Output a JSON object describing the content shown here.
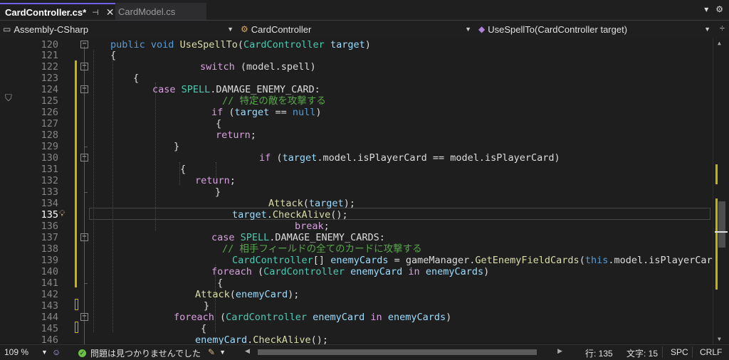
{
  "tabs": [
    {
      "label": "CardController.cs*",
      "pin": "⊣",
      "close": "✕"
    },
    {
      "label": "CardModel.cs"
    }
  ],
  "nav": {
    "project": "Assembly-CSharp",
    "class": "CardController",
    "member": "UseSpellTo(CardController target)"
  },
  "line_numbers": [
    "120",
    "121",
    "122",
    "123",
    "124",
    "125",
    "126",
    "127",
    "128",
    "129",
    "130",
    "131",
    "132",
    "133",
    "134",
    "135",
    "136",
    "137",
    "138",
    "139",
    "140",
    "141",
    "142",
    "143",
    "144",
    "145",
    "146"
  ],
  "current_line": "135",
  "code_lines": [
    [
      {
        "c": "kw",
        "t": "public"
      },
      {
        "c": "pln",
        "t": " "
      },
      {
        "c": "kw",
        "t": "void"
      },
      {
        "c": "pln",
        "t": " "
      },
      {
        "c": "mth",
        "t": "UseSpellTo"
      },
      {
        "c": "pln",
        "t": "("
      },
      {
        "c": "typ",
        "t": "CardController"
      },
      {
        "c": "pln",
        "t": " "
      },
      {
        "c": "prm",
        "t": "target"
      },
      {
        "c": "pln",
        "t": ")"
      }
    ],
    [
      {
        "c": "pln",
        "t": "{"
      }
    ],
    [
      {
        "c": "ctl",
        "t": "switch"
      },
      {
        "c": "pln",
        "t": " (model.spell)"
      }
    ],
    [
      {
        "c": "pln",
        "t": "{"
      }
    ],
    [
      {
        "c": "ctl",
        "t": "case"
      },
      {
        "c": "pln",
        "t": " "
      },
      {
        "c": "typ",
        "t": "SPELL"
      },
      {
        "c": "pln",
        "t": ".DAMAGE_ENEMY_CARD:"
      }
    ],
    [
      {
        "c": "cmt",
        "t": "// 特定の敵を攻撃する"
      }
    ],
    [
      {
        "c": "ctl",
        "t": "if"
      },
      {
        "c": "pln",
        "t": " ("
      },
      {
        "c": "prm",
        "t": "target"
      },
      {
        "c": "pln",
        "t": " == "
      },
      {
        "c": "kw",
        "t": "null"
      },
      {
        "c": "pln",
        "t": ")"
      }
    ],
    [
      {
        "c": "pln",
        "t": "{"
      }
    ],
    [
      {
        "c": "ctl",
        "t": "return"
      },
      {
        "c": "pln",
        "t": ";"
      }
    ],
    [
      {
        "c": "pln",
        "t": "}"
      }
    ],
    [
      {
        "c": "ctl",
        "t": "if"
      },
      {
        "c": "pln",
        "t": " ("
      },
      {
        "c": "prm",
        "t": "target"
      },
      {
        "c": "pln",
        "t": ".model.isPlayerCard == model.isPlayerCard)"
      }
    ],
    [
      {
        "c": "pln",
        "t": "{"
      }
    ],
    [
      {
        "c": "ctl",
        "t": "return"
      },
      {
        "c": "pln",
        "t": ";"
      }
    ],
    [
      {
        "c": "pln",
        "t": "}"
      }
    ],
    [
      {
        "c": "mth",
        "t": "Attack"
      },
      {
        "c": "pln",
        "t": "("
      },
      {
        "c": "prm",
        "t": "target"
      },
      {
        "c": "pln",
        "t": ");"
      }
    ],
    [
      {
        "c": "prm",
        "t": "target"
      },
      {
        "c": "pln",
        "t": "."
      },
      {
        "c": "mth",
        "t": "CheckAlive"
      },
      {
        "c": "pln",
        "t": "();"
      }
    ],
    [
      {
        "c": "ctl",
        "t": "break"
      },
      {
        "c": "pln",
        "t": ";"
      }
    ],
    [
      {
        "c": "ctl",
        "t": "case"
      },
      {
        "c": "pln",
        "t": " "
      },
      {
        "c": "typ",
        "t": "SPELL"
      },
      {
        "c": "pln",
        "t": ".DAMAGE_ENEMY_CARDS:"
      }
    ],
    [
      {
        "c": "cmt",
        "t": "// 相手フィールドの全てのカードに攻撃する"
      }
    ],
    [
      {
        "c": "typ",
        "t": "CardController"
      },
      {
        "c": "pln",
        "t": "[] "
      },
      {
        "c": "prm",
        "t": "enemyCards"
      },
      {
        "c": "pln",
        "t": " = gameManager."
      },
      {
        "c": "mth",
        "t": "GetEnemyFieldCards"
      },
      {
        "c": "pln",
        "t": "("
      },
      {
        "c": "kw",
        "t": "this"
      },
      {
        "c": "pln",
        "t": ".model.isPlayerCard);"
      }
    ],
    [
      {
        "c": "ctl",
        "t": "foreach"
      },
      {
        "c": "pln",
        "t": " ("
      },
      {
        "c": "typ",
        "t": "CardController"
      },
      {
        "c": "pln",
        "t": " "
      },
      {
        "c": "prm",
        "t": "enemyCard"
      },
      {
        "c": "pln",
        "t": " "
      },
      {
        "c": "ctl",
        "t": "in"
      },
      {
        "c": "pln",
        "t": " "
      },
      {
        "c": "prm",
        "t": "enemyCards"
      },
      {
        "c": "pln",
        "t": ")"
      }
    ],
    [
      {
        "c": "pln",
        "t": "{"
      }
    ],
    [
      {
        "c": "mth",
        "t": "Attack"
      },
      {
        "c": "pln",
        "t": "("
      },
      {
        "c": "prm",
        "t": "enemyCard"
      },
      {
        "c": "pln",
        "t": ");"
      }
    ],
    [
      {
        "c": "pln",
        "t": "}"
      }
    ],
    [
      {
        "c": "ctl",
        "t": "foreach"
      },
      {
        "c": "pln",
        "t": " ("
      },
      {
        "c": "typ",
        "t": "CardController"
      },
      {
        "c": "pln",
        "t": " "
      },
      {
        "c": "prm",
        "t": "enemyCard"
      },
      {
        "c": "pln",
        "t": " "
      },
      {
        "c": "ctl",
        "t": "in"
      },
      {
        "c": "pln",
        "t": " "
      },
      {
        "c": "prm",
        "t": "enemyCards"
      },
      {
        "c": "pln",
        "t": ")"
      }
    ],
    [
      {
        "c": "pln",
        "t": "{"
      }
    ],
    [
      {
        "c": "prm",
        "t": "enemyCard"
      },
      {
        "c": "pln",
        "t": "."
      },
      {
        "c": "mth",
        "t": "CheckAlive"
      },
      {
        "c": "pln",
        "t": "();"
      }
    ]
  ],
  "status": {
    "zoom": "109 %",
    "issues": "問題は見つかりませんでした",
    "line": "行: 135",
    "char": "文字: 15",
    "spc": "SPC",
    "crlf": "CRLF"
  },
  "colors": {
    "accent": "#7160e8",
    "change_marker": "#c7b600",
    "ok_green": "#6cc04a"
  }
}
